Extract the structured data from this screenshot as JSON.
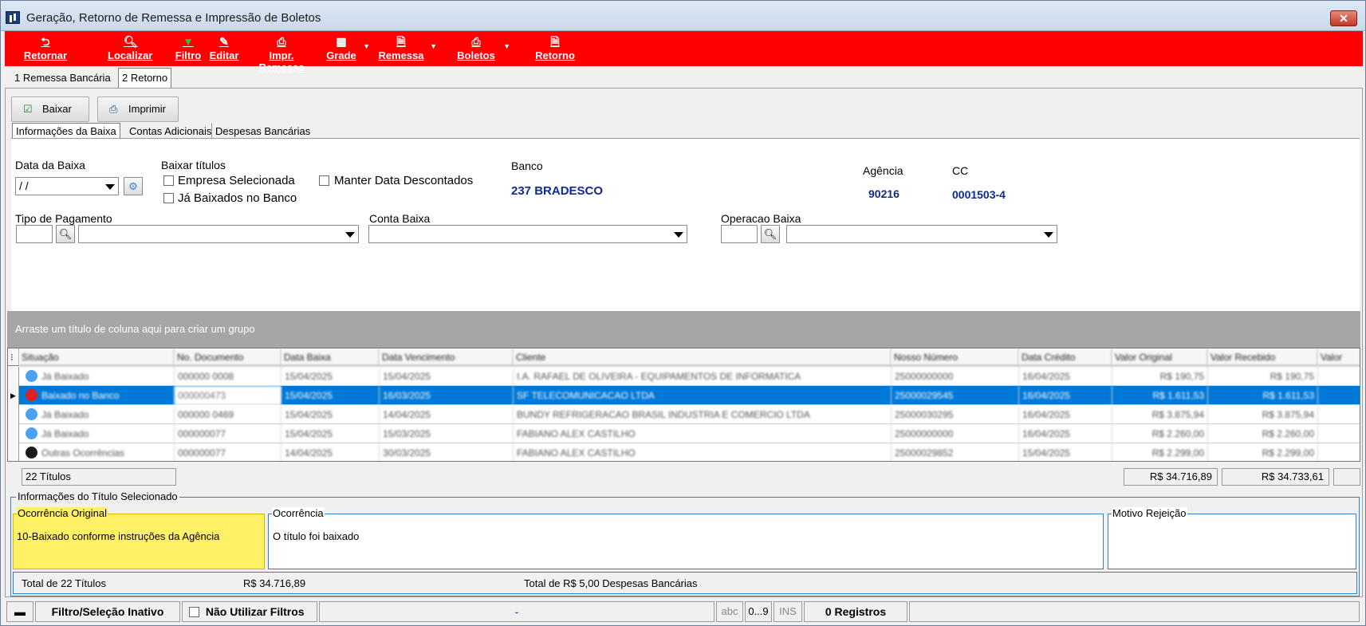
{
  "window": {
    "title": "Geração, Retorno de Remessa e Impressão de Boletos",
    "close": "✕"
  },
  "toolbar": {
    "retornar": "Retornar",
    "localizar": "Localizar",
    "filtro": "Filtro",
    "editar": "Editar",
    "impr_remessa": "Impr. Remessa",
    "grade": "Grade",
    "remessa": "Remessa",
    "boletos": "Boletos",
    "retorno": "Retorno"
  },
  "main_tabs": [
    "1 Remessa Bancária",
    "2 Retorno"
  ],
  "actions": {
    "baixar": "Baixar",
    "imprimir": "Imprimir"
  },
  "info_tabs": [
    "Informações da Baixa",
    "Contas Adicionais",
    "Despesas Bancárias"
  ],
  "form": {
    "data_baixa_label": "Data da Baixa",
    "data_baixa_value": " / /",
    "baixar_titulos_label": "Baixar títulos",
    "empresa_selecionada": "Empresa Selecionada",
    "ja_baixados": "Já Baixados no Banco",
    "manter_data": "Manter Data Descontados",
    "banco_label": "Banco",
    "banco_value": "237 BRADESCO",
    "agencia_label": "Agência",
    "agencia_value": "90216",
    "cc_label": "CC",
    "cc_value": "0001503-4",
    "tipo_pagamento_label": "Tipo de Pagamento",
    "conta_baixa_label": "Conta Baixa",
    "operacao_baixa_label": "Operacao Baixa"
  },
  "group_hint": "Arraste um título de coluna aqui para criar um grupo",
  "grid": {
    "columns": [
      "Situação",
      "No. Documento",
      "Data Baixa",
      "Data Vencimento",
      "Cliente",
      "Nosso Número",
      "Data Crédito",
      "Valor Original",
      "Valor Recebido",
      "Valor"
    ],
    "rows": [
      {
        "situacao": "Já Baixado",
        "doc": "000000 0008",
        "baixa": "15/04/2025",
        "venc": "15/04/2025",
        "cliente": "I.A. RAFAEL DE OLIVEIRA - EQUIPAMENTOS DE INFORMATICA",
        "nosso": "25000000000",
        "credito": "16/04/2025",
        "original": "R$ 190,75",
        "recebido": "R$ 190,75",
        "color": "#4aa3f0",
        "selected": false
      },
      {
        "situacao": "Baixado no Banco",
        "doc": "000000473",
        "baixa": "15/04/2025",
        "venc": "16/03/2025",
        "cliente": "SF TELECOMUNICACAO LTDA",
        "nosso": "25000029545",
        "credito": "16/04/2025",
        "original": "R$ 1.611,53",
        "recebido": "R$ 1.611,53",
        "color": "#e02020",
        "selected": true
      },
      {
        "situacao": "Já Baixado",
        "doc": "000000 0469",
        "baixa": "15/04/2025",
        "venc": "14/04/2025",
        "cliente": "BUNDY REFRIGERACAO BRASIL INDUSTRIA E COMERCIO LTDA",
        "nosso": "25000030295",
        "credito": "16/04/2025",
        "original": "R$ 3.875,94",
        "recebido": "R$ 3.875,94",
        "color": "#4aa3f0",
        "selected": false
      },
      {
        "situacao": "Já Baixado",
        "doc": "000000077",
        "baixa": "15/04/2025",
        "venc": "15/03/2025",
        "cliente": "FABIANO ALEX CASTILHO",
        "nosso": "25000000000",
        "credito": "16/04/2025",
        "original": "R$ 2.260,00",
        "recebido": "R$ 2.260,00",
        "color": "#4aa3f0",
        "selected": false
      },
      {
        "situacao": "Outras Ocorrências",
        "doc": "000000077",
        "baixa": "14/04/2025",
        "venc": "30/03/2025",
        "cliente": "FABIANO ALEX CASTILHO",
        "nosso": "25000029852",
        "credito": "15/04/2025",
        "original": "R$ 2.299,00",
        "recebido": "R$ 2.299,00",
        "color": "#1a1a1a",
        "selected": false
      }
    ]
  },
  "summary": {
    "titulos": "22 Títulos",
    "total_original": "R$ 34.716,89",
    "total_recebido": "R$ 34.733,61"
  },
  "selected_info": {
    "group_label": "Informações do Título Selecionado",
    "ocorrencia_original_label": "Ocorrência Original",
    "ocorrencia_original_value": "10-Baixado conforme instruções da Agência",
    "ocorrencia_label": "Ocorrência",
    "ocorrencia_value": "O título foi baixado",
    "motivo_label": "Motivo Rejeição"
  },
  "totals": {
    "total_titulos": "Total de 22  Títulos",
    "total_valor": "R$ 34.716,89",
    "despesas": "Total de R$ 5,00 Despesas Bancárias"
  },
  "statusbar": {
    "filtro": "Filtro/Seleção Inativo",
    "nao_utilizar": "Não Utilizar Filtros",
    "dash": "-",
    "abc": "abc",
    "num": "0...9",
    "ins": "INS",
    "registros": "0 Registros"
  },
  "colors": {
    "toolbar": "#ff0000",
    "selection": "#0078d7",
    "highlight": "#fff066",
    "link_blue": "#0f2b8c"
  }
}
